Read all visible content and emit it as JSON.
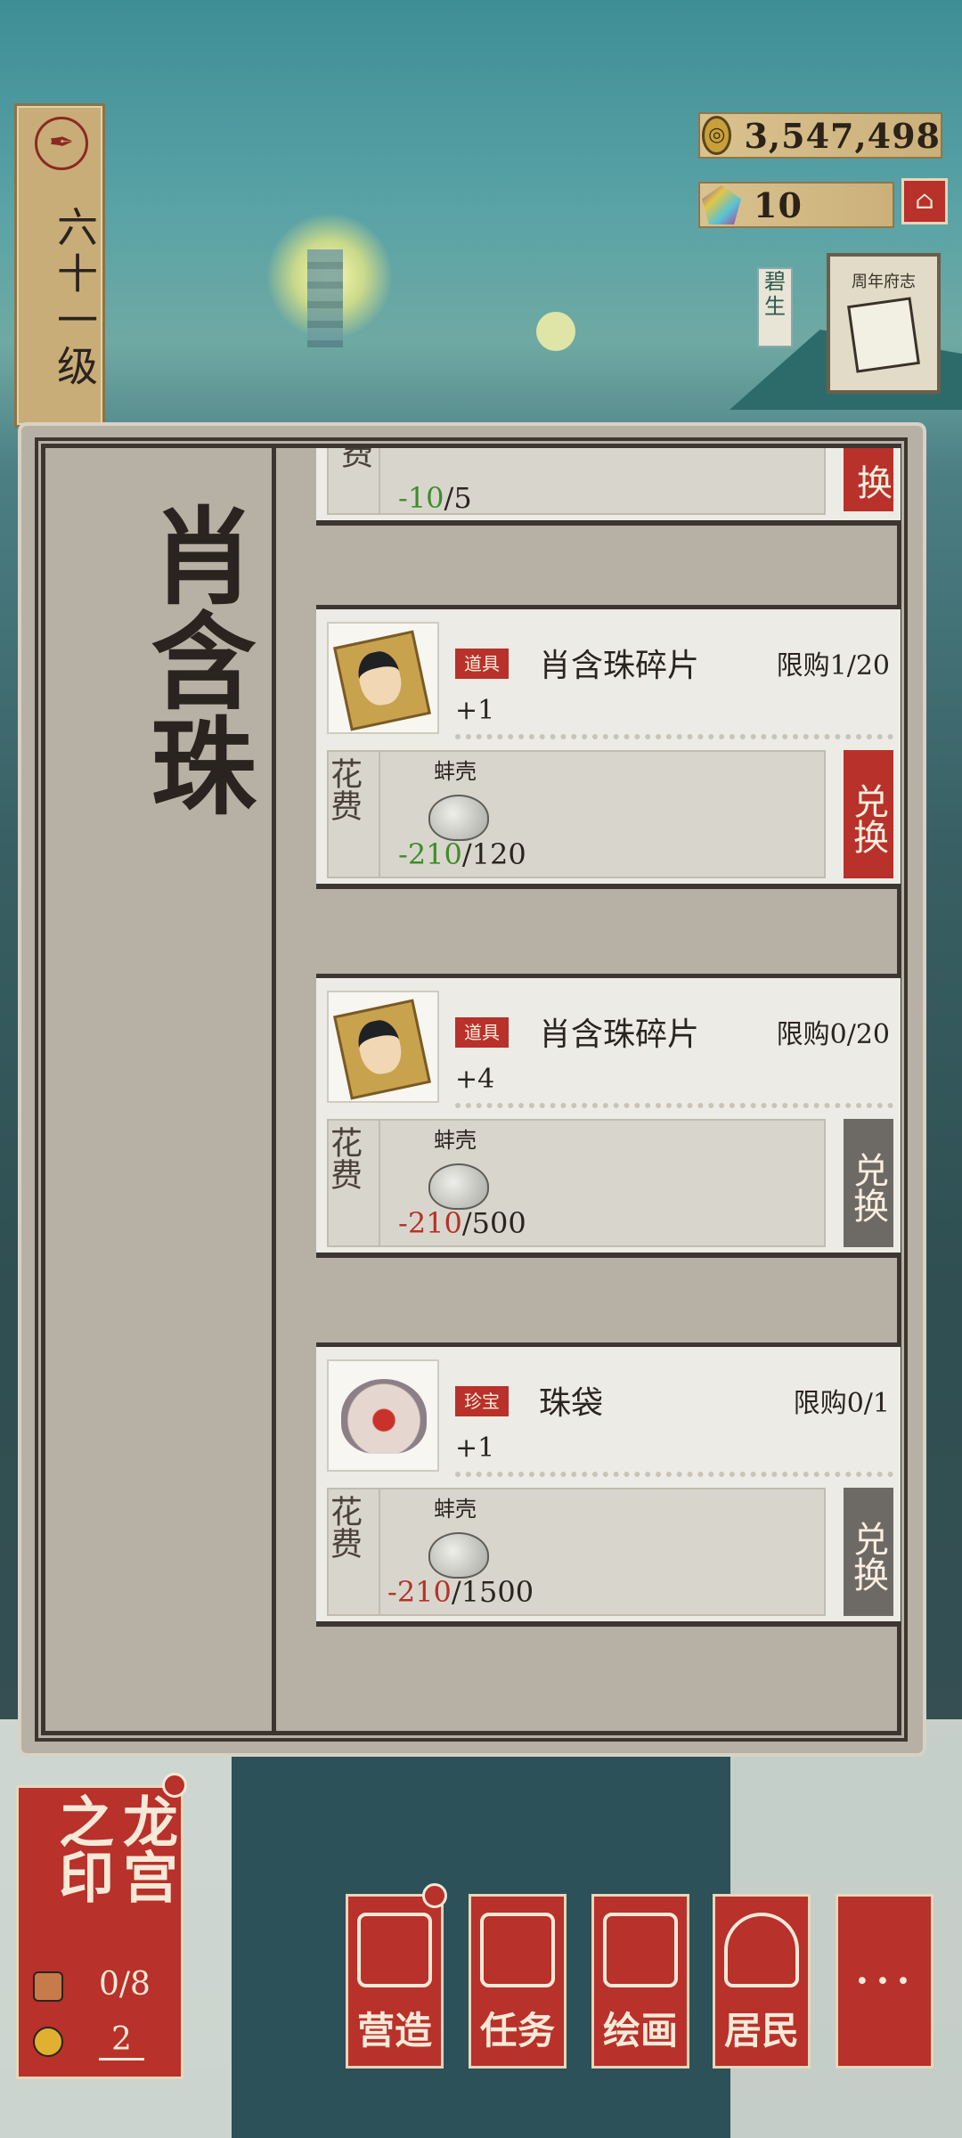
{
  "level": {
    "label": "六十一级"
  },
  "currencies": {
    "coins": "3,547,498",
    "gems": "10"
  },
  "chronicle": {
    "label": "周年府志"
  },
  "side_tag": {
    "label": "碧生"
  },
  "panel": {
    "title": "肖含珠",
    "cost_label": "花费",
    "exchange_label": "兑换",
    "items": [
      {
        "tag": "",
        "name": "",
        "limit": "",
        "qty": "",
        "material": "",
        "cost_have": "-10",
        "cost_need": "/5",
        "have_color": "green",
        "enabled": true,
        "partial": true
      },
      {
        "tag": "道具",
        "name": "肖含珠碎片",
        "limit": "限购1/20",
        "qty": "+1",
        "material": "蚌壳",
        "cost_have": "-210",
        "cost_need": "/120",
        "have_color": "green",
        "enabled": true
      },
      {
        "tag": "道具",
        "name": "肖含珠碎片",
        "limit": "限购0/20",
        "qty": "+4",
        "material": "蚌壳",
        "cost_have": "-210",
        "cost_need": "/500",
        "have_color": "red",
        "enabled": false
      },
      {
        "tag": "珍宝",
        "name": "珠袋",
        "limit": "限购0/1",
        "qty": "+1",
        "material": "蚌壳",
        "cost_have": "-210",
        "cost_need": "/1500",
        "have_color": "red",
        "enabled": false
      }
    ]
  },
  "seal": {
    "title": "龙宫之印",
    "count": "0/8",
    "num": "2"
  },
  "nav": [
    {
      "label": "营造",
      "icon": "building-icon"
    },
    {
      "label": "任务",
      "icon": "task-book-icon"
    },
    {
      "label": "绘画",
      "icon": "scroll-icon"
    },
    {
      "label": "居民",
      "icon": "resident-icon"
    },
    {
      "label": "···",
      "icon": "more-icon"
    }
  ],
  "colors": {
    "accent_red": "#b8312a",
    "green": "#3f8d2a",
    "parchment": "#ecebe5",
    "disabled": "#6d6a66"
  }
}
